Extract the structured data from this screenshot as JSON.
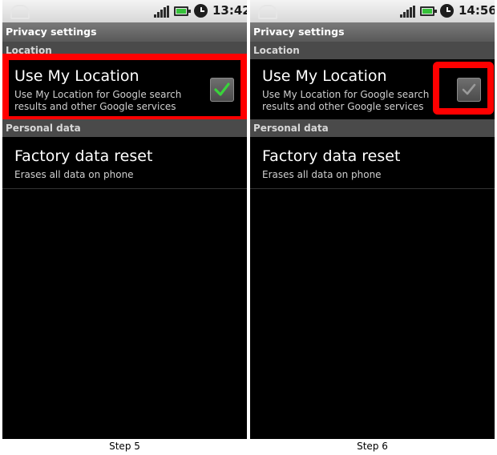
{
  "panels": [
    {
      "status": {
        "time": "13:42"
      },
      "title": "Privacy settings",
      "section_location": "Location",
      "use_location": {
        "title": "Use My Location",
        "subtitle_line1": "Use My Location for Google search",
        "subtitle_line2": "results and other Google services",
        "checked": true
      },
      "section_personal": "Personal data",
      "factory_reset": {
        "title": "Factory data reset",
        "subtitle": "Erases all data on phone"
      },
      "caption": "Step 5"
    },
    {
      "status": {
        "time": "14:56"
      },
      "title": "Privacy settings",
      "section_location": "Location",
      "use_location": {
        "title": "Use My Location",
        "subtitle_line1": "Use My Location for Google search",
        "subtitle_line2": "results and other Google services",
        "checked": false
      },
      "section_personal": "Personal data",
      "factory_reset": {
        "title": "Factory data reset",
        "subtitle": "Erases all data on phone"
      },
      "caption": "Step 6"
    }
  ],
  "colors": {
    "highlight": "#ff0000",
    "check_on": "#39d43b",
    "check_off": "#9a9a9a"
  }
}
